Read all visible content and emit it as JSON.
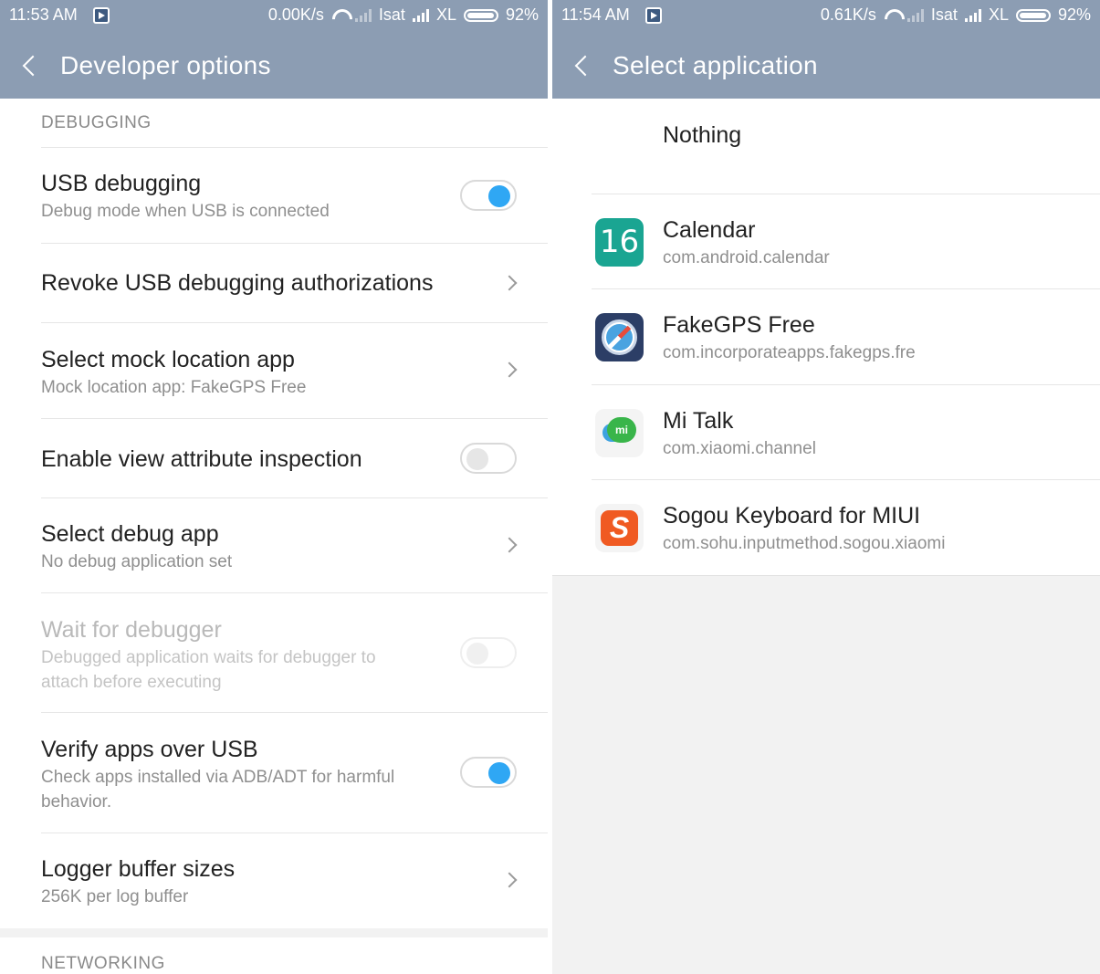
{
  "left": {
    "status": {
      "time": "11:53 AM",
      "speed": "0.00K/s",
      "carrier1": "Isat",
      "carrier2": "XL",
      "battery": "92%"
    },
    "title": "Developer  options",
    "sections": {
      "debugging": "DEBUGGING",
      "networking": "NETWORKING"
    },
    "rows": [
      {
        "title": "USB debugging",
        "subtitle": "Debug mode when USB is connected",
        "control": "toggle",
        "state": "on"
      },
      {
        "title": "Revoke USB debugging authorizations",
        "control": "chevron"
      },
      {
        "title": "Select mock location app",
        "subtitle": "Mock location app: FakeGPS Free",
        "control": "chevron"
      },
      {
        "title": "Enable view attribute inspection",
        "control": "toggle",
        "state": "off"
      },
      {
        "title": "Select debug app",
        "subtitle": "No debug application set",
        "control": "chevron"
      },
      {
        "title": "Wait for debugger",
        "subtitle_line1": "Debugged application waits for debugger to",
        "subtitle_line2": "attach before executing",
        "control": "toggle",
        "state": "disabled"
      },
      {
        "title": "Verify apps over USB",
        "subtitle_line1": "Check apps installed via ADB/ADT for harmful",
        "subtitle_line2": "behavior.",
        "control": "toggle",
        "state": "on"
      },
      {
        "title": "Logger buffer sizes",
        "subtitle": "256K per log buffer",
        "control": "chevron"
      }
    ]
  },
  "right": {
    "status": {
      "time": "11:54 AM",
      "speed": "0.61K/s",
      "carrier1": "Isat",
      "carrier2": "XL",
      "battery": "92%"
    },
    "title": "Select  application",
    "nothing_label": "Nothing",
    "apps": [
      {
        "name": "Calendar",
        "package": "com.android.calendar",
        "icon": "calendar-icon",
        "icon_text": "16"
      },
      {
        "name": "FakeGPS Free",
        "package": "com.incorporateapps.fakegps.fre",
        "icon": "compass-icon"
      },
      {
        "name": "Mi Talk",
        "package": "com.xiaomi.channel",
        "icon": "mi-talk-icon",
        "icon_text": "mi"
      },
      {
        "name": "Sogou Keyboard for MIUI",
        "package": "com.sohu.inputmethod.sogou.xiaomi",
        "icon": "sogou-icon",
        "icon_text": "S"
      }
    ]
  },
  "colors": {
    "header": "#8c9db3",
    "toggle_on": "#2fa7f4",
    "text_primary": "#222222",
    "text_secondary": "#8f8f8f"
  }
}
